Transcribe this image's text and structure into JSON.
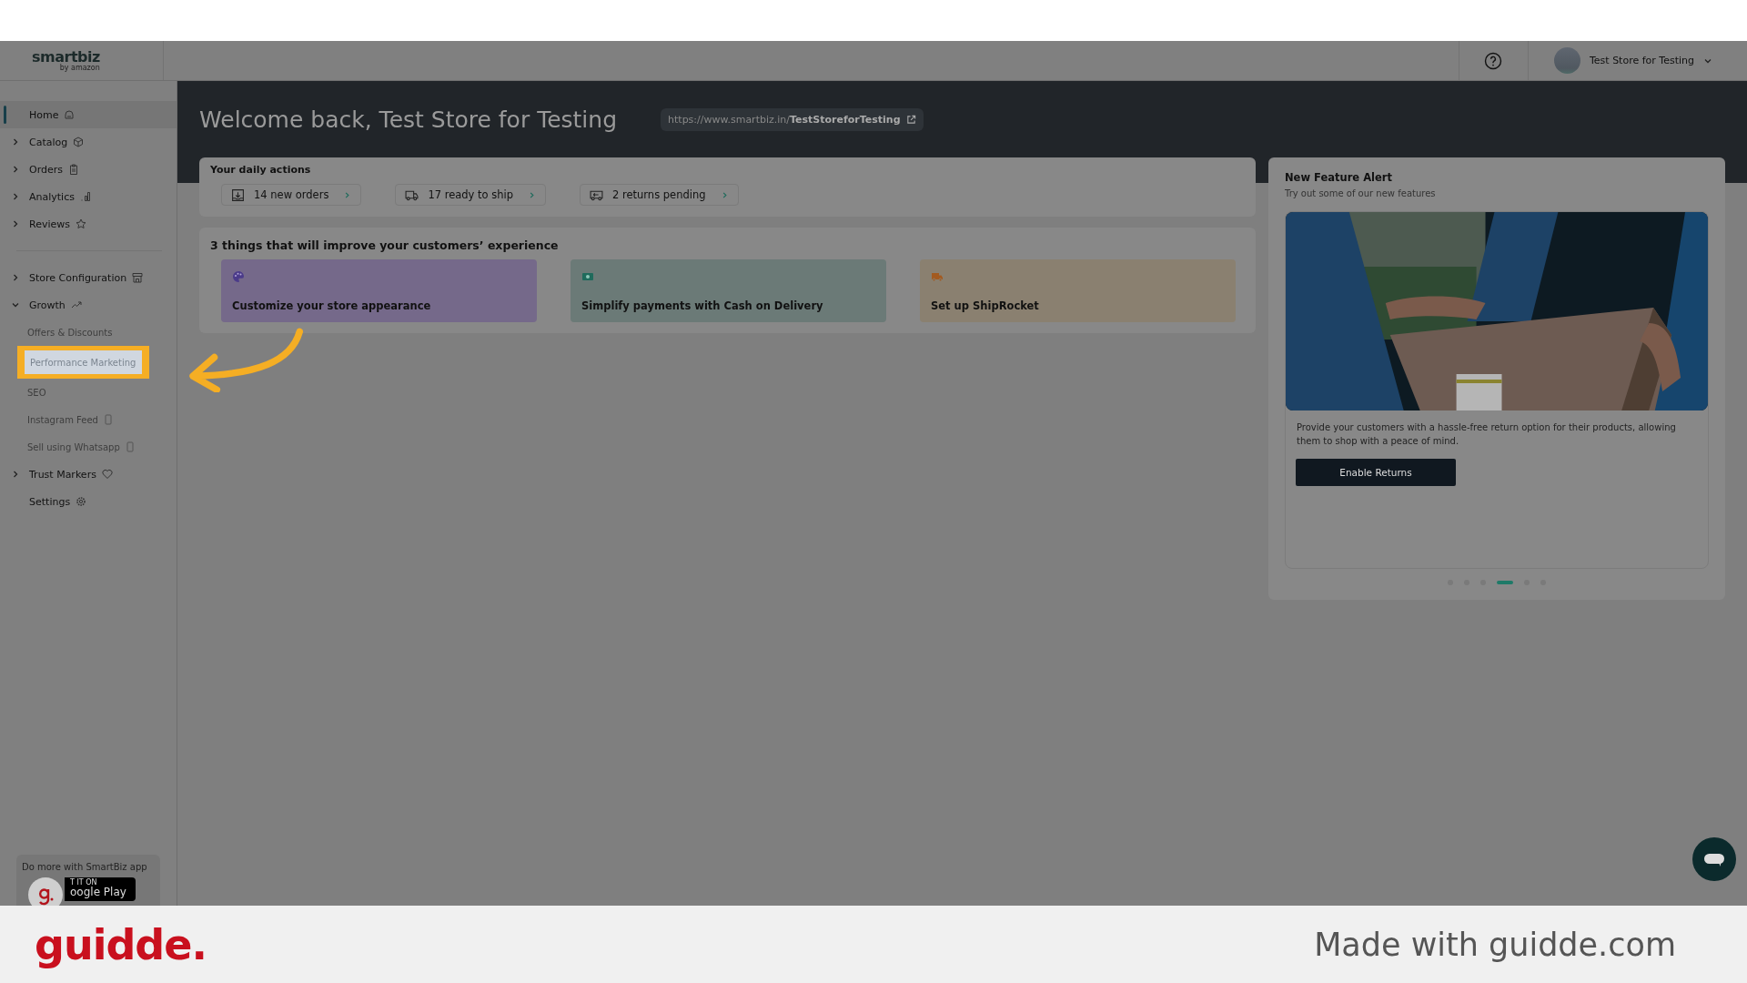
{
  "header": {
    "logo": "smartbiz",
    "logo_sub": "by amazon",
    "account_name": "Test Store for Testing"
  },
  "sidebar": {
    "sections": [
      {
        "items": [
          {
            "label": "Home",
            "selected": true
          },
          {
            "label": "Catalog",
            "expanded": false,
            "selected": false
          },
          {
            "label": "Orders",
            "expanded": false,
            "selected": false
          },
          {
            "label": "Analytics",
            "expanded": false,
            "selected": false
          },
          {
            "label": "Reviews",
            "expanded": false,
            "selected": false
          }
        ]
      },
      {
        "items": [
          {
            "label": "Store Configuration",
            "expanded": false,
            "selected": false
          },
          {
            "label": "Growth",
            "expanded": true,
            "selected": false,
            "children": [
              {
                "label": "Offers & Discounts",
                "selected": false,
                "highlighted": false
              },
              {
                "label": "Performance Marketing",
                "selected": true,
                "highlighted": true
              },
              {
                "label": "SEO",
                "selected": false,
                "highlighted": false
              },
              {
                "label": "Instagram Feed",
                "selected": false,
                "highlighted": false
              },
              {
                "label": "Sell using Whatsapp",
                "selected": false,
                "highlighted": false
              }
            ]
          },
          {
            "label": "Trust Markers",
            "expanded": false,
            "selected": false
          },
          {
            "label": "Settings",
            "selected": false
          }
        ]
      }
    ],
    "promo": {
      "text": "Do more with SmartBiz app",
      "badge_top": "T IT ON",
      "badge_bottom": "oogle Play"
    }
  },
  "banner": {
    "title": "Welcome back, Test Store for Testing",
    "url": "https://www.smartbiz.in/**TestStoreforTesting**"
  },
  "daily_actions": {
    "title": "Your daily actions",
    "items": [
      "14 new orders",
      "17 ready to ship",
      "2 returns pending"
    ]
  },
  "improve": {
    "title": "3 things that will improve your customers’ experience",
    "tiles": [
      {
        "label": "Customize your store appearance",
        "color": "#75698a"
      },
      {
        "label": "Simplify payments with Cash on Delivery",
        "color": "#6b7a77"
      },
      {
        "label": "Set up ShipRocket",
        "color": "#8a8070"
      }
    ]
  },
  "feature_alert": {
    "title": "New Feature Alert",
    "subtitle": "Try out some of our new features",
    "description": "Provide your customers with a hassle-free return option for their products, allowing them to shop with a peace of mind.",
    "button": "Enable Returns",
    "slides": [
      {
        "selected": false
      },
      {
        "selected": false
      },
      {
        "selected": false
      },
      {
        "selected": true
      },
      {
        "selected": false
      },
      {
        "selected": false
      }
    ]
  },
  "footer": {
    "brand": "guidde.",
    "credit": "Made with guidde.com"
  }
}
